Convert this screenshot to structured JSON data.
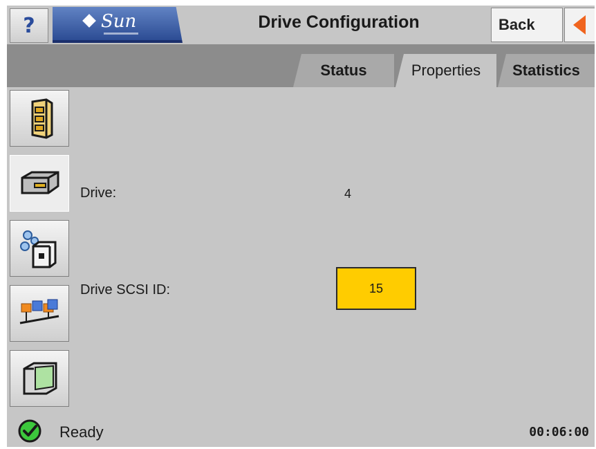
{
  "header": {
    "help_label": "?",
    "logo_text": "Sun",
    "title": "Drive Configuration",
    "back_label": "Back",
    "back_arrow_color": "#f0641e",
    "logo_color": "#2c4c94"
  },
  "tabs": [
    {
      "label": "Status",
      "active": false
    },
    {
      "label": "Properties",
      "active": true
    },
    {
      "label": "Statistics",
      "active": false
    }
  ],
  "sidebar": {
    "items": [
      {
        "icon": "library-cabinet-icon",
        "active": false
      },
      {
        "icon": "tape-drive-icon",
        "active": true
      },
      {
        "icon": "media-cartridge-icon",
        "active": false
      },
      {
        "icon": "network-connection-icon",
        "active": false
      },
      {
        "icon": "display-panel-icon",
        "active": false
      }
    ]
  },
  "properties": {
    "drive_label": "Drive:",
    "drive_value": "4",
    "scsi_label": "Drive SCSI ID:",
    "scsi_value": "15",
    "scsi_field_color": "#ffcc00"
  },
  "status": {
    "text": "Ready",
    "icon": "check-circle-icon",
    "icon_color": "#3cc83c",
    "time": "00:06:00"
  }
}
